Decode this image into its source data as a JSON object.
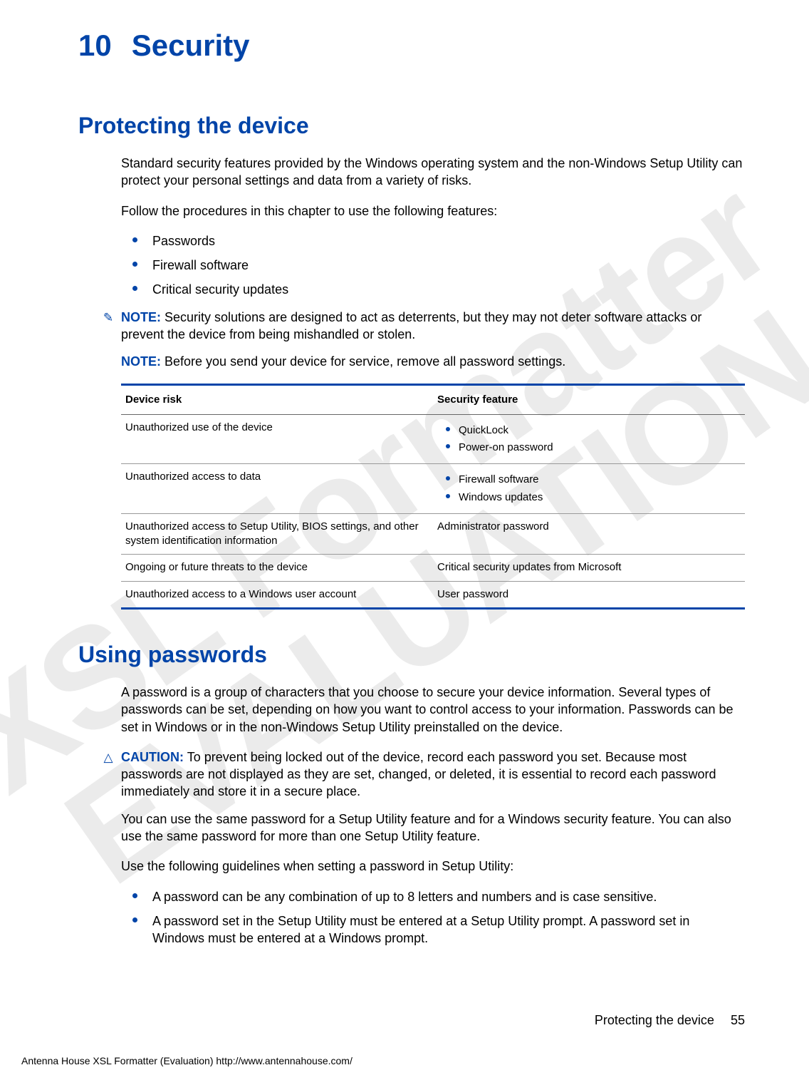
{
  "watermark": {
    "line1": "XSL Formatter",
    "line2": "EVALUATION"
  },
  "chapter": {
    "number": "10",
    "title": "Security"
  },
  "section1": {
    "heading": "Protecting the device",
    "p1": "Standard security features provided by the Windows operating system and the non-Windows Setup Utility can protect your personal settings and data from a variety of risks.",
    "p2": "Follow the procedures in this chapter to use the following features:",
    "bullets": [
      "Passwords",
      "Firewall software",
      "Critical security updates"
    ],
    "note1": {
      "label": "NOTE:",
      "text": "Security solutions are designed to act as deterrents, but they may not deter software attacks or prevent the device from being mishandled or stolen."
    },
    "note2": {
      "label": "NOTE:",
      "text": "Before you send your device for service, remove all password settings."
    },
    "table": {
      "headers": [
        "Device risk",
        "Security feature"
      ],
      "rows": [
        {
          "risk": "Unauthorized use of the device",
          "feature_list": [
            "QuickLock",
            "Power-on password"
          ]
        },
        {
          "risk": "Unauthorized access to data",
          "feature_list": [
            "Firewall software",
            "Windows updates"
          ]
        },
        {
          "risk": "Unauthorized access to Setup Utility, BIOS settings, and other system identification information",
          "feature_text": "Administrator password"
        },
        {
          "risk": "Ongoing or future threats to the device",
          "feature_text": "Critical security updates from Microsoft"
        },
        {
          "risk": "Unauthorized access to a Windows user account",
          "feature_text": "User password"
        }
      ]
    }
  },
  "section2": {
    "heading": "Using passwords",
    "p1": "A password is a group of characters that you choose to secure your device information. Several types of passwords can be set, depending on how you want to control access to your information. Passwords can be set in Windows or in the non-Windows Setup Utility preinstalled on the device.",
    "caution": {
      "label": "CAUTION:",
      "text": "To prevent being locked out of the device, record each password you set. Because most passwords are not displayed as they are set, changed, or deleted, it is essential to record each password immediately and store it in a secure place."
    },
    "p2": "You can use the same password for a Setup Utility feature and for a Windows security feature. You can also use the same password for more than one Setup Utility feature.",
    "p3": "Use the following guidelines when setting a password in Setup Utility:",
    "bullets": [
      "A password can be any combination of up to 8 letters and numbers and is case sensitive.",
      "A password set in the Setup Utility must be entered at a Setup Utility prompt. A password set in Windows must be entered at a Windows prompt."
    ]
  },
  "footer": {
    "section": "Protecting the device",
    "page": "55",
    "credit": "Antenna House XSL Formatter (Evaluation)  http://www.antennahouse.com/"
  }
}
